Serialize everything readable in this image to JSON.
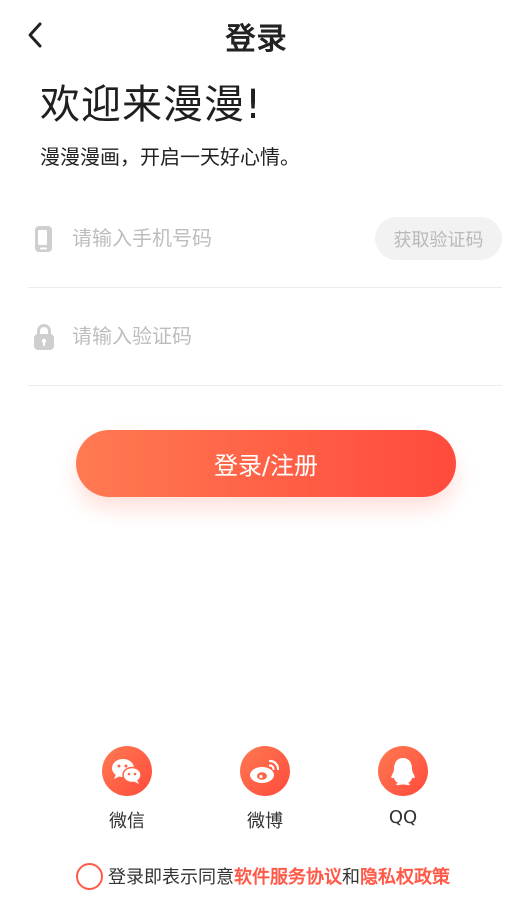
{
  "header": {
    "title": "登录",
    "back_icon": "chevron-left-icon"
  },
  "welcome": {
    "title": "欢迎来漫漫!",
    "subtitle": "漫漫漫画，开启一天好心情。"
  },
  "form": {
    "phone_icon": "phone-icon",
    "phone_placeholder": "请输入手机号码",
    "phone_value": "",
    "get_code_label": "获取验证码",
    "lock_icon": "lock-icon",
    "code_placeholder": "请输入验证码",
    "code_value": ""
  },
  "login_button_label": "登录/注册",
  "social": [
    {
      "label": "微信",
      "icon": "wechat-icon"
    },
    {
      "label": "微博",
      "icon": "weibo-icon"
    },
    {
      "label": "QQ",
      "icon": "qq-icon"
    }
  ],
  "agreement": {
    "prefix": "登录即表示同意",
    "link1": "软件服务协议",
    "conjunction": "和",
    "link2": "隐私权政策",
    "checked": false
  },
  "colors": {
    "accent": "#ff5a48",
    "gradient_start": "#ff7a52",
    "gradient_end": "#ff4a3c",
    "placeholder": "#bdbdbd",
    "divider": "#ececec"
  }
}
